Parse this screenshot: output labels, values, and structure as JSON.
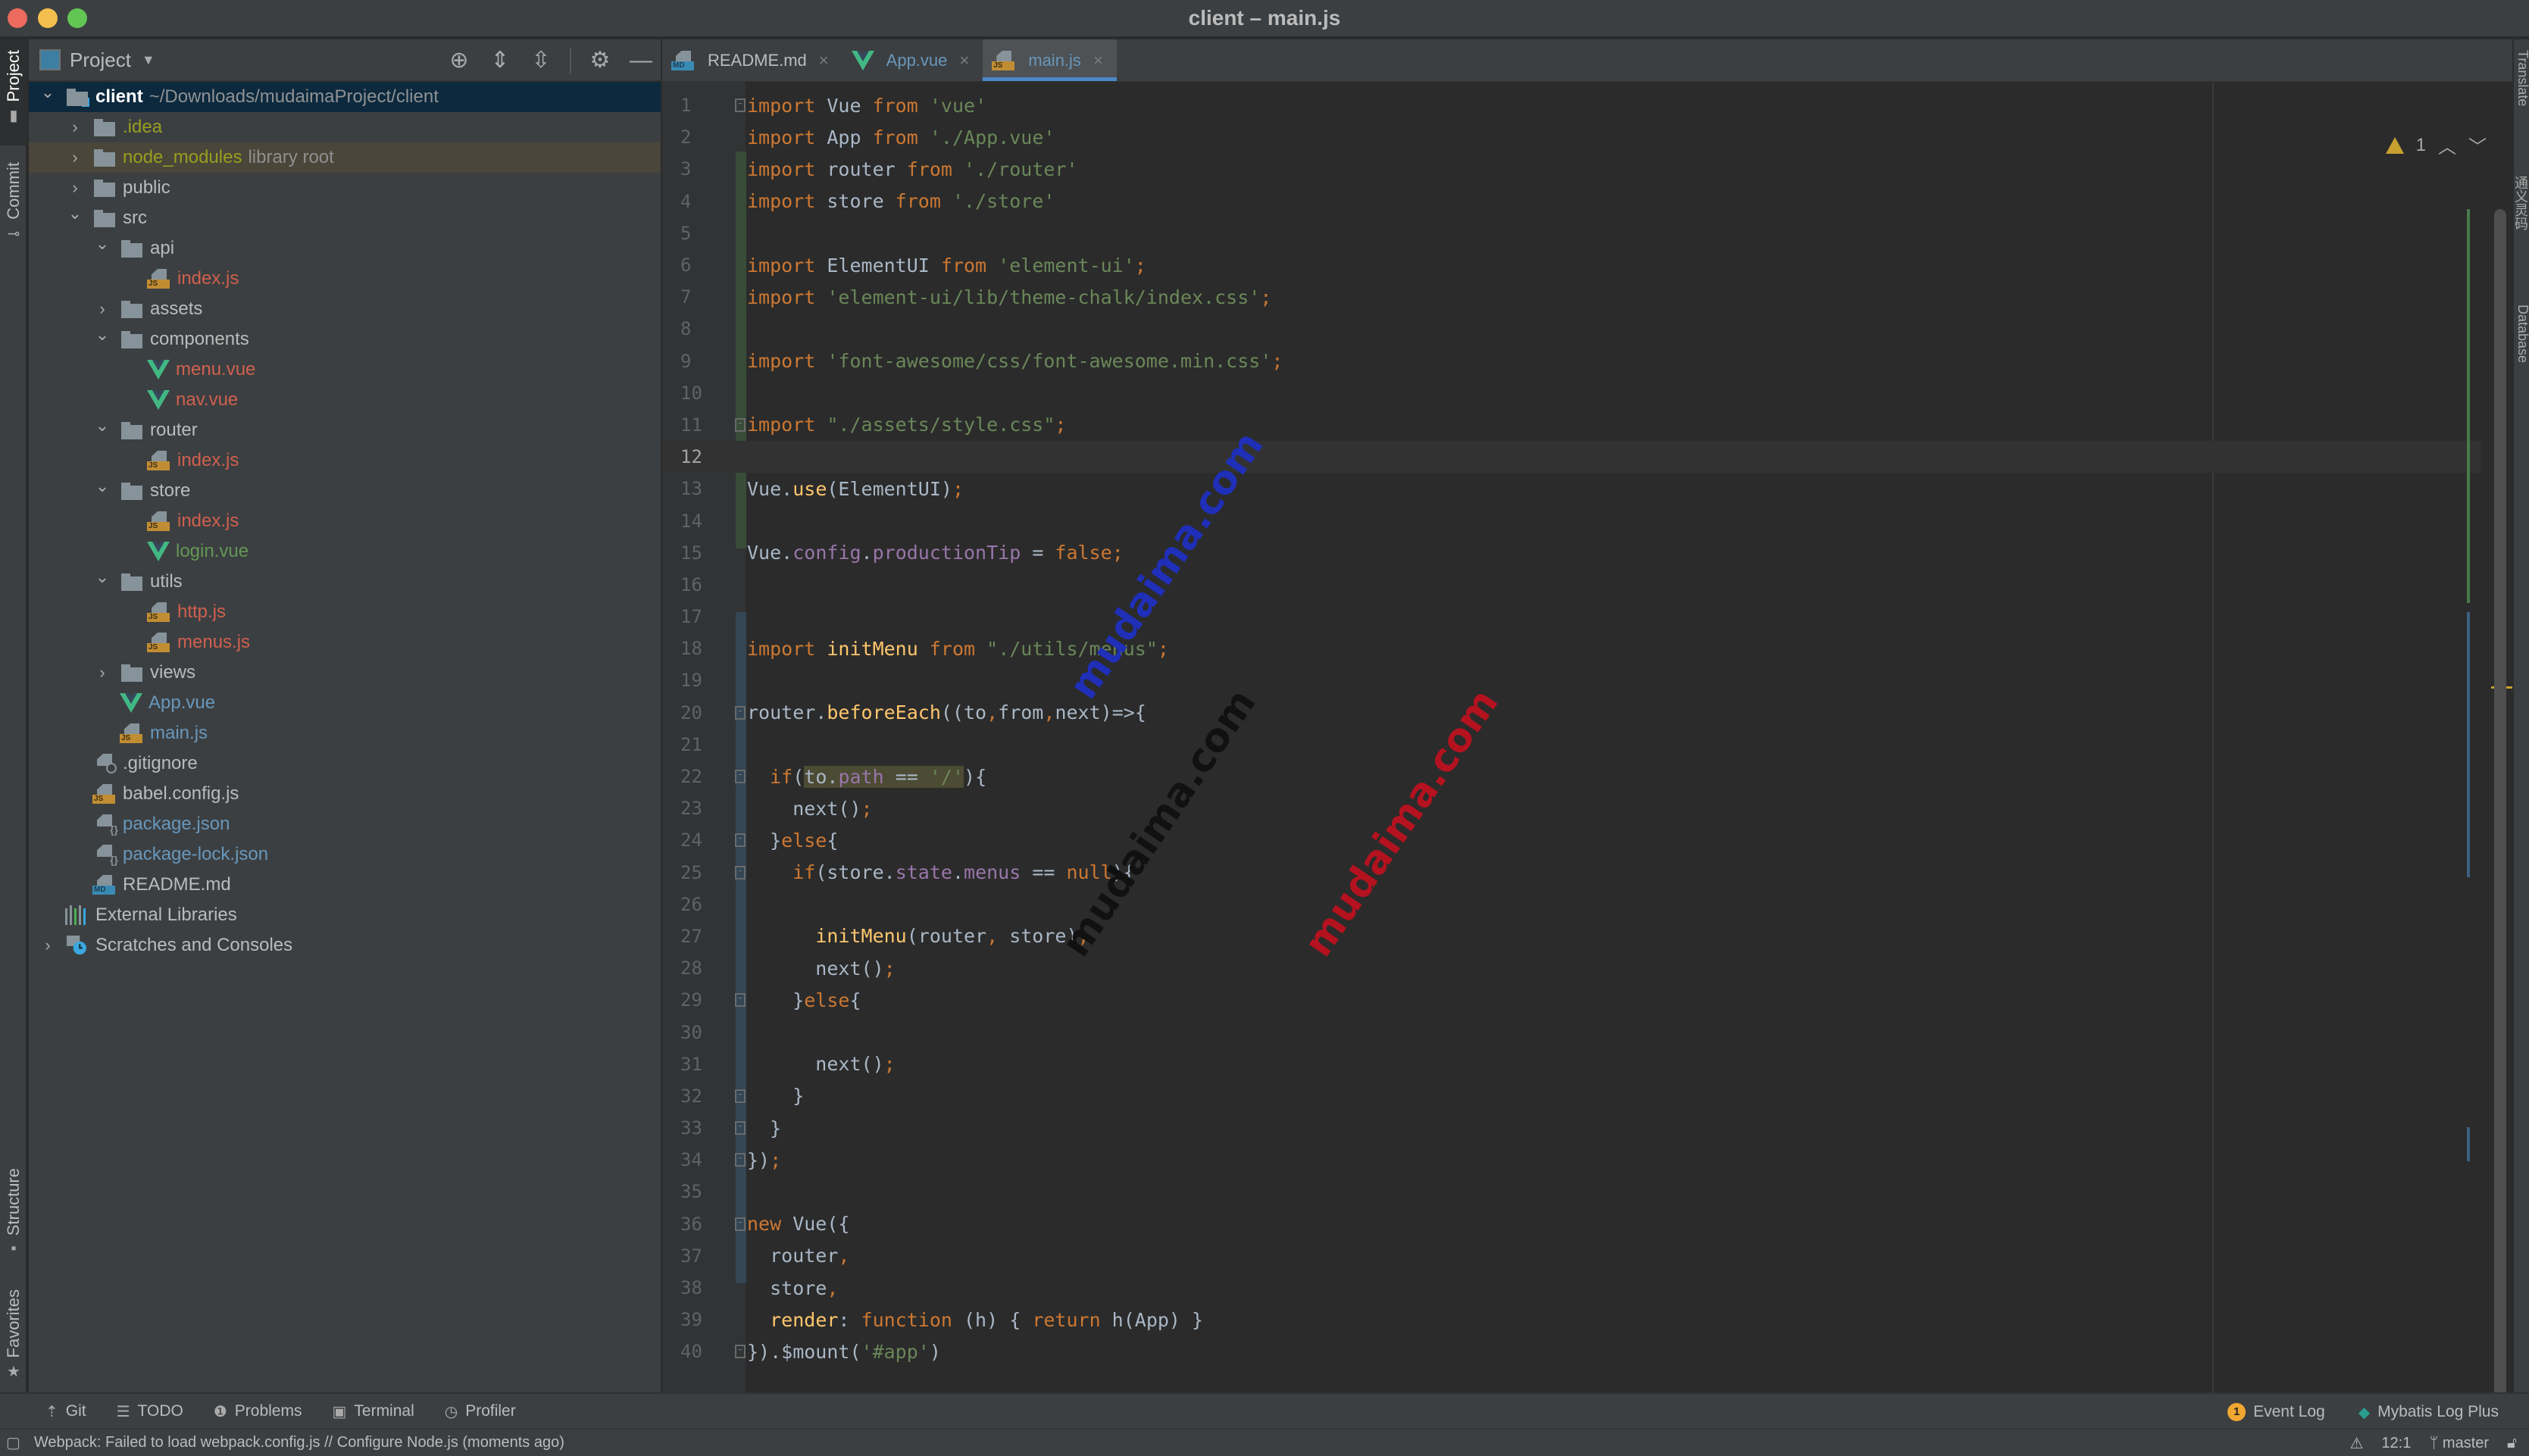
{
  "window": {
    "title": "client – main.js"
  },
  "left_strip": {
    "tabs": [
      {
        "label": "Project",
        "icon": "folder-icon",
        "active": true
      },
      {
        "label": "Commit",
        "icon": "commit-icon",
        "active": false
      },
      {
        "label": "Structure",
        "icon": "structure-icon",
        "active": false
      },
      {
        "label": "Favorites",
        "icon": "star-icon",
        "active": false
      }
    ]
  },
  "project_panel": {
    "title": "Project",
    "tools": [
      "locate-icon",
      "expand-all-icon",
      "collapse-all-icon",
      "gear-icon",
      "hide-icon"
    ],
    "tree": [
      {
        "name": "client",
        "extra": "~/Downloads/mudaimaProject/client",
        "type": "root",
        "depth": 0,
        "expanded": true,
        "status": "client"
      },
      {
        "name": ".idea",
        "type": "folder",
        "depth": 1,
        "expanded": false,
        "status": "ignored"
      },
      {
        "name": "node_modules",
        "extra": "library root",
        "type": "folder",
        "depth": 1,
        "expanded": false,
        "status": "ignored"
      },
      {
        "name": "public",
        "type": "folder",
        "depth": 1,
        "expanded": false,
        "status": "default"
      },
      {
        "name": "src",
        "type": "folder",
        "depth": 1,
        "expanded": true,
        "status": "default"
      },
      {
        "name": "api",
        "type": "folder",
        "depth": 2,
        "expanded": true,
        "status": "default"
      },
      {
        "name": "index.js",
        "type": "js",
        "depth": 3,
        "status": "untracked"
      },
      {
        "name": "assets",
        "type": "folder",
        "depth": 2,
        "expanded": false,
        "status": "default"
      },
      {
        "name": "components",
        "type": "folder",
        "depth": 2,
        "expanded": true,
        "status": "default"
      },
      {
        "name": "menu.vue",
        "type": "vue",
        "depth": 3,
        "status": "untracked"
      },
      {
        "name": "nav.vue",
        "type": "vue",
        "depth": 3,
        "status": "untracked"
      },
      {
        "name": "router",
        "type": "folder",
        "depth": 2,
        "expanded": true,
        "status": "default"
      },
      {
        "name": "index.js",
        "type": "js",
        "depth": 3,
        "status": "untracked"
      },
      {
        "name": "store",
        "type": "folder",
        "depth": 2,
        "expanded": true,
        "status": "default"
      },
      {
        "name": "index.js",
        "type": "js",
        "depth": 3,
        "status": "untracked"
      },
      {
        "name": "login.vue",
        "type": "vue",
        "depth": 3,
        "status": "added"
      },
      {
        "name": "utils",
        "type": "folder",
        "depth": 2,
        "expanded": true,
        "status": "default"
      },
      {
        "name": "http.js",
        "type": "js",
        "depth": 3,
        "status": "untracked"
      },
      {
        "name": "menus.js",
        "type": "js",
        "depth": 3,
        "status": "untracked"
      },
      {
        "name": "views",
        "type": "folder",
        "depth": 2,
        "expanded": false,
        "status": "default"
      },
      {
        "name": "App.vue",
        "type": "vue",
        "depth": 2,
        "status": "modified"
      },
      {
        "name": "main.js",
        "type": "js",
        "depth": 2,
        "status": "modified"
      },
      {
        "name": ".gitignore",
        "type": "gitignore",
        "depth": 1,
        "status": "default"
      },
      {
        "name": "babel.config.js",
        "type": "js",
        "depth": 1,
        "status": "default"
      },
      {
        "name": "package.json",
        "type": "json",
        "depth": 1,
        "status": "modified"
      },
      {
        "name": "package-lock.json",
        "type": "json",
        "depth": 1,
        "status": "modified"
      },
      {
        "name": "README.md",
        "type": "md",
        "depth": 1,
        "status": "default"
      },
      {
        "name": "External Libraries",
        "type": "extlib",
        "depth": 0,
        "status": "default"
      },
      {
        "name": "Scratches and Consoles",
        "type": "scratch",
        "depth": 0,
        "expanded": false,
        "status": "default"
      }
    ]
  },
  "editor": {
    "tabs": [
      {
        "label": "README.md",
        "icon": "md",
        "active": false,
        "status": "default"
      },
      {
        "label": "App.vue",
        "icon": "vue",
        "active": false,
        "status": "modified"
      },
      {
        "label": "main.js",
        "icon": "js",
        "active": true,
        "status": "modified"
      }
    ],
    "warning_count": "1",
    "caret_line": 12,
    "lines": [
      [
        [
          "kw",
          "import"
        ],
        [
          "t",
          " Vue "
        ],
        [
          "kw",
          "from"
        ],
        [
          "t",
          " "
        ],
        [
          "str",
          "'vue'"
        ]
      ],
      [
        [
          "kw",
          "import"
        ],
        [
          "t",
          " App "
        ],
        [
          "kw",
          "from"
        ],
        [
          "t",
          " "
        ],
        [
          "str",
          "'./App.vue'"
        ]
      ],
      [
        [
          "kw",
          "import"
        ],
        [
          "t",
          " router "
        ],
        [
          "kw",
          "from"
        ],
        [
          "t",
          " "
        ],
        [
          "str",
          "'./router'"
        ]
      ],
      [
        [
          "kw",
          "import"
        ],
        [
          "t",
          " store "
        ],
        [
          "kw",
          "from"
        ],
        [
          "t",
          " "
        ],
        [
          "str",
          "'./store'"
        ]
      ],
      [],
      [
        [
          "kw",
          "import"
        ],
        [
          "t",
          " ElementUI "
        ],
        [
          "kw",
          "from"
        ],
        [
          "t",
          " "
        ],
        [
          "str",
          "'element-ui'"
        ],
        [
          "punc",
          ";"
        ]
      ],
      [
        [
          "kw",
          "import"
        ],
        [
          "t",
          " "
        ],
        [
          "str",
          "'element-ui/lib/theme-chalk/index.css'"
        ],
        [
          "punc",
          ";"
        ]
      ],
      [],
      [
        [
          "kw",
          "import"
        ],
        [
          "t",
          " "
        ],
        [
          "str",
          "'font-awesome/css/font-awesome.min.css'"
        ],
        [
          "punc",
          ";"
        ]
      ],
      [],
      [
        [
          "kw",
          "import"
        ],
        [
          "t",
          " "
        ],
        [
          "str",
          "\"./assets/style.css\""
        ],
        [
          "punc",
          ";"
        ]
      ],
      [],
      [
        [
          "t",
          "Vue."
        ],
        [
          "fn",
          "use"
        ],
        [
          "t",
          "(ElementUI)"
        ],
        [
          "punc",
          ";"
        ]
      ],
      [],
      [
        [
          "t",
          "Vue."
        ],
        [
          "prop",
          "config"
        ],
        [
          "t",
          "."
        ],
        [
          "prop",
          "productionTip"
        ],
        [
          "t",
          " = "
        ],
        [
          "kw",
          "false"
        ],
        [
          "punc",
          ";"
        ]
      ],
      [],
      [],
      [
        [
          "kw",
          "import"
        ],
        [
          "t",
          " "
        ],
        [
          "fn",
          "initMenu"
        ],
        [
          "t",
          " "
        ],
        [
          "kw",
          "from"
        ],
        [
          "t",
          " "
        ],
        [
          "str",
          "\"./utils/menus\""
        ],
        [
          "punc",
          ";"
        ]
      ],
      [],
      [
        [
          "t",
          "router."
        ],
        [
          "fn",
          "beforeEach"
        ],
        [
          "t",
          "((to"
        ],
        [
          "punc",
          ","
        ],
        [
          "t",
          "from"
        ],
        [
          "punc",
          ","
        ],
        [
          "t",
          "next)=>{"
        ]
      ],
      [],
      [
        [
          "t",
          "  "
        ],
        [
          "kw",
          "if"
        ],
        [
          "t",
          "("
        ],
        [
          "hlt",
          "to."
        ],
        [
          "hlp",
          "path"
        ],
        [
          "hlt",
          " == "
        ],
        [
          "hls",
          "'/'"
        ],
        [
          "t",
          "){"
        ]
      ],
      [
        [
          "t",
          "    next()"
        ],
        [
          "punc",
          ";"
        ]
      ],
      [
        [
          "t",
          "  }"
        ],
        [
          "kw",
          "else"
        ],
        [
          "t",
          "{"
        ]
      ],
      [
        [
          "t",
          "    "
        ],
        [
          "kw",
          "if"
        ],
        [
          "t",
          "(store."
        ],
        [
          "prop",
          "state"
        ],
        [
          "t",
          "."
        ],
        [
          "prop",
          "menus"
        ],
        [
          "t",
          " == "
        ],
        [
          "kw",
          "null"
        ],
        [
          "t",
          "){"
        ]
      ],
      [],
      [
        [
          "t",
          "      "
        ],
        [
          "fn",
          "initMenu"
        ],
        [
          "t",
          "(router"
        ],
        [
          "punc",
          ","
        ],
        [
          "t",
          " store)"
        ],
        [
          "punc",
          ";"
        ]
      ],
      [
        [
          "t",
          "      next()"
        ],
        [
          "punc",
          ";"
        ]
      ],
      [
        [
          "t",
          "    }"
        ],
        [
          "kw",
          "else"
        ],
        [
          "t",
          "{"
        ]
      ],
      [],
      [
        [
          "t",
          "      next()"
        ],
        [
          "punc",
          ";"
        ]
      ],
      [
        [
          "t",
          "    }"
        ]
      ],
      [
        [
          "t",
          "  }"
        ]
      ],
      [
        [
          "t",
          "})"
        ],
        [
          "punc",
          ";"
        ]
      ],
      [],
      [
        [
          "kw",
          "new"
        ],
        [
          "t",
          " Vue({"
        ]
      ],
      [
        [
          "t",
          "  router"
        ],
        [
          "punc",
          ","
        ]
      ],
      [
        [
          "t",
          "  store"
        ],
        [
          "punc",
          ","
        ]
      ],
      [
        [
          "t",
          "  "
        ],
        [
          "fn",
          "render"
        ],
        [
          "t",
          ": "
        ],
        [
          "kw",
          "function"
        ],
        [
          "t",
          " (h) { "
        ],
        [
          "kw",
          "return"
        ],
        [
          "t",
          " h(App) }"
        ]
      ],
      [
        [
          "t",
          "})."
        ],
        [
          "t",
          "$mount("
        ],
        [
          "str",
          "'#app'"
        ],
        [
          "t",
          ")"
        ]
      ]
    ],
    "fold_lines": [
      1,
      11,
      20,
      22,
      24,
      25,
      29,
      32,
      33,
      34,
      36,
      40
    ]
  },
  "right_strip": {
    "tabs": [
      "Translate",
      "通义灵码",
      "Database"
    ]
  },
  "bottom_tools": {
    "left": [
      {
        "label": "Git",
        "icon": "git-icon"
      },
      {
        "label": "TODO",
        "icon": "todo-list-icon"
      },
      {
        "label": "Problems",
        "icon": "problems-icon"
      },
      {
        "label": "Terminal",
        "icon": "terminal-icon"
      },
      {
        "label": "Profiler",
        "icon": "profiler-icon"
      }
    ],
    "right": [
      {
        "label": "Event Log",
        "badge": "1"
      },
      {
        "label": "Mybatis Log Plus"
      }
    ]
  },
  "status_bar": {
    "message": "Webpack: Failed to load webpack.config.js // Configure Node.js (moments ago)",
    "position": "12:1",
    "branch": "master"
  },
  "watermarks": [
    "mudaima.com",
    "mudaima.com",
    "mudaima.com"
  ],
  "colors": {
    "accent": "#4a88c7",
    "keyword": "#cc7832",
    "string": "#6a8759",
    "function": "#ffc66d",
    "property": "#9876aa",
    "untracked": "#d0604f",
    "modified": "#6897bb",
    "added": "#629755",
    "ignored": "#999e1f",
    "warning": "#c7a02f"
  }
}
